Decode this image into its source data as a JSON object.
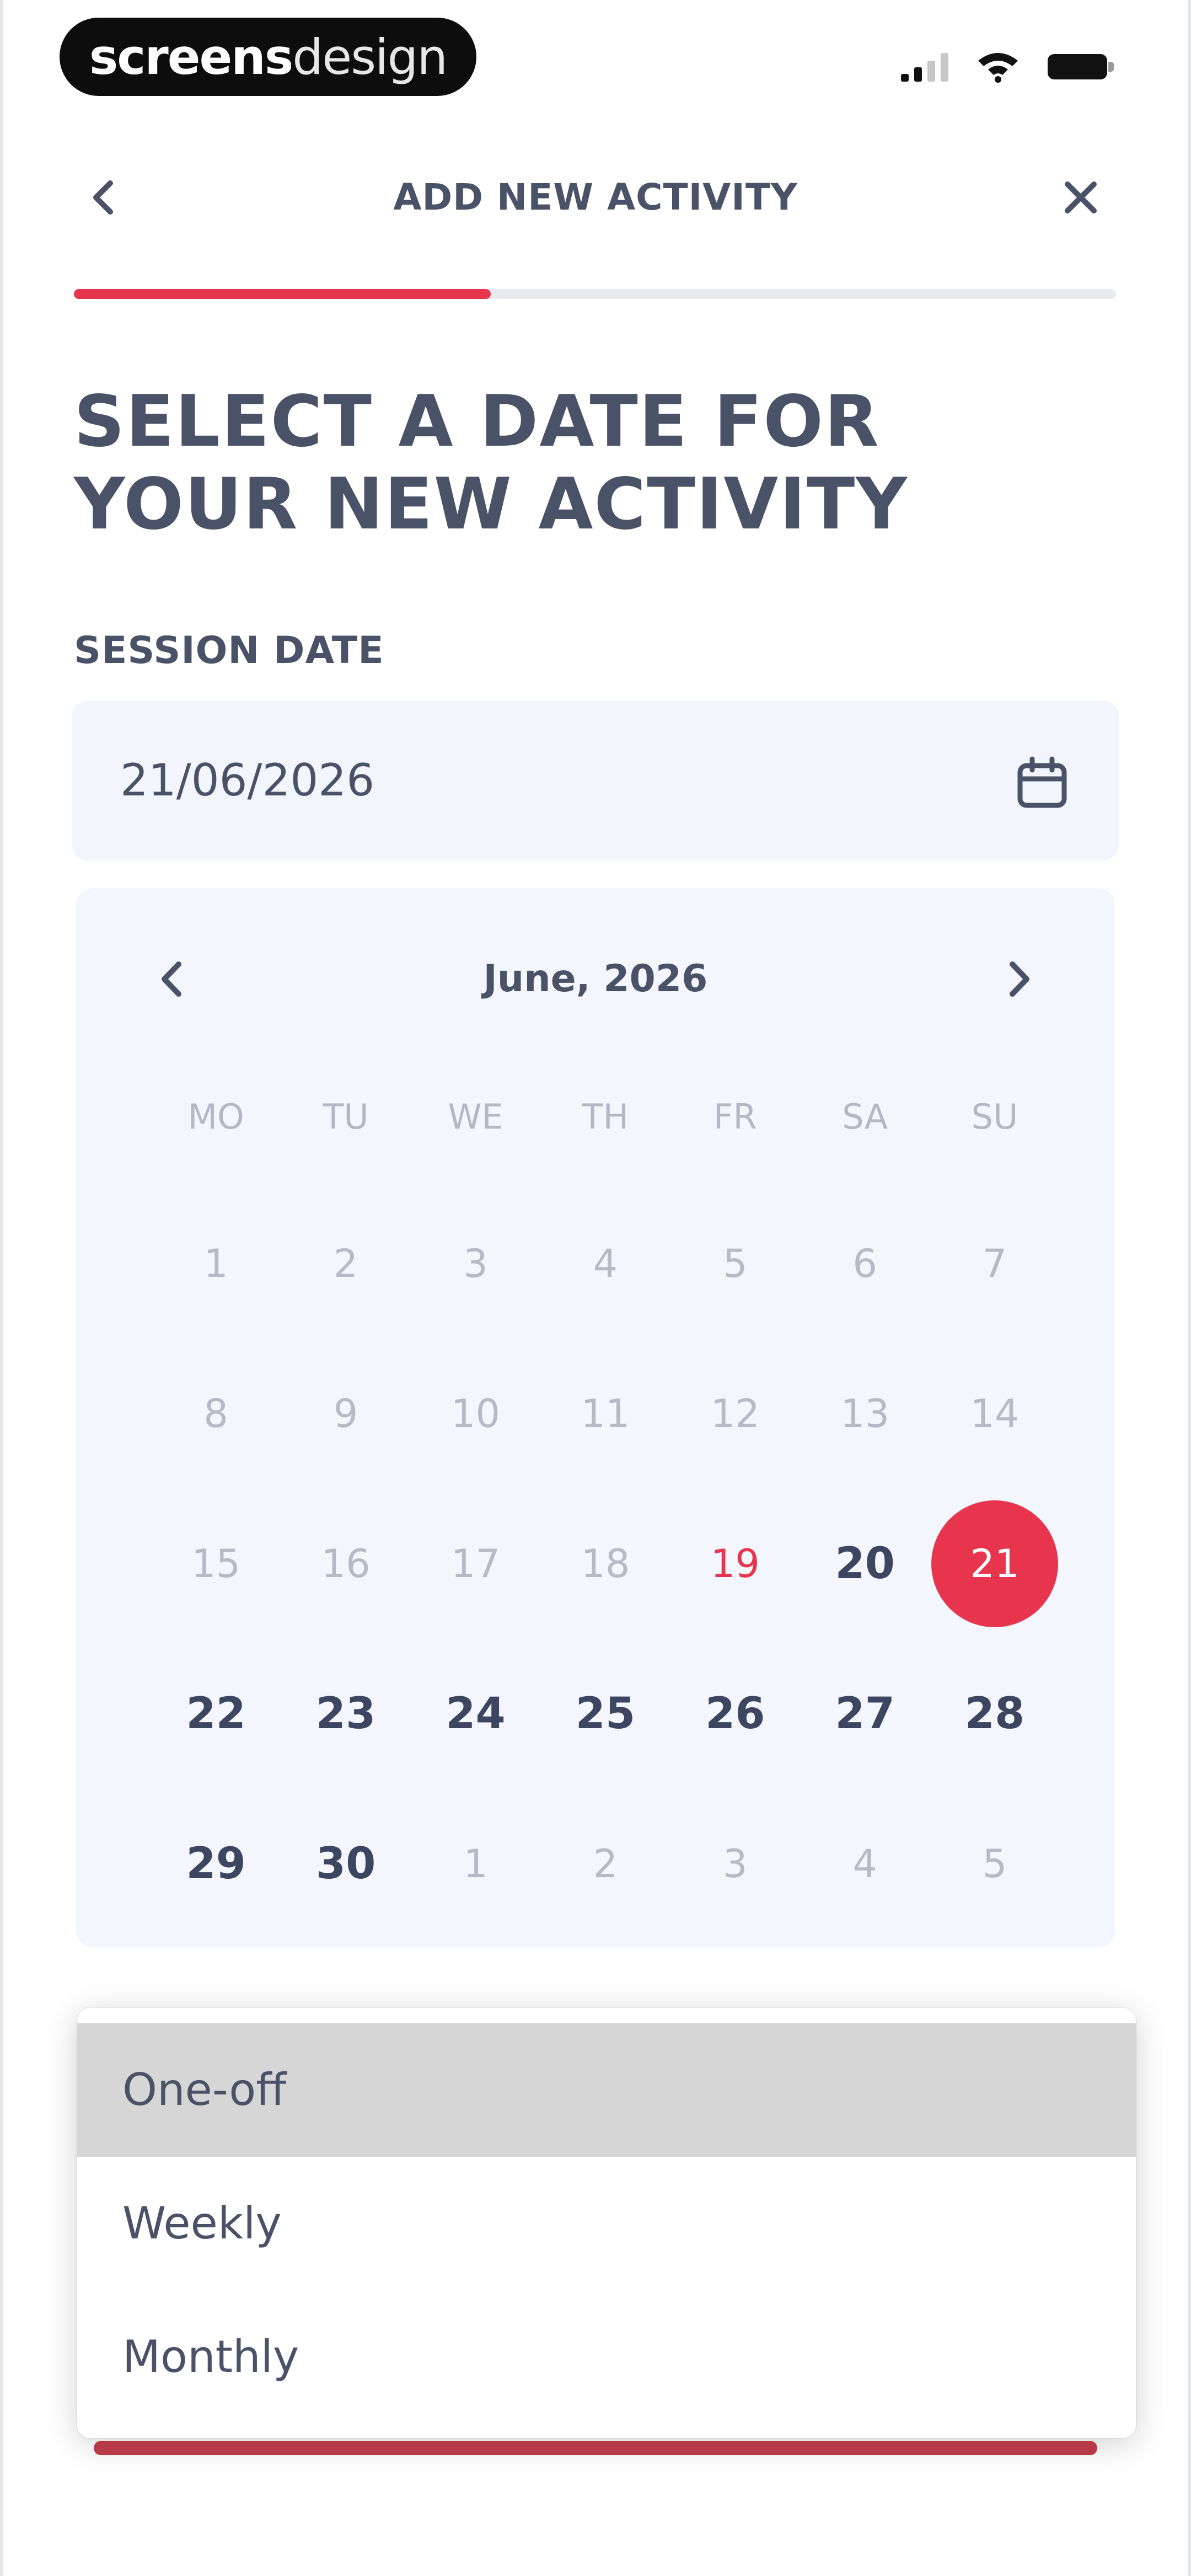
{
  "status_bar": {
    "brand_part1": "screens",
    "brand_part2": "design"
  },
  "header": {
    "title": "ADD NEW ACTIVITY",
    "back_icon": "chevron-left-icon",
    "close_icon": "close-icon"
  },
  "progress": {
    "fraction": 0.4
  },
  "title": "SELECT A DATE FOR YOUR NEW ACTIVITY",
  "session_date": {
    "label": "SESSION DATE",
    "value": "21/06/2026",
    "icon": "calendar-icon"
  },
  "calendar": {
    "month": "June, 2026",
    "weekdays": [
      "MO",
      "TU",
      "WE",
      "TH",
      "FR",
      "SA",
      "SU"
    ],
    "days": [
      {
        "label": "1"
      },
      {
        "label": "2"
      },
      {
        "label": "3"
      },
      {
        "label": "4"
      },
      {
        "label": "5"
      },
      {
        "label": "6"
      },
      {
        "label": "7"
      },
      {
        "label": "8"
      },
      {
        "label": "9"
      },
      {
        "label": "10"
      },
      {
        "label": "11"
      },
      {
        "label": "12"
      },
      {
        "label": "13"
      },
      {
        "label": "14"
      },
      {
        "label": "15"
      },
      {
        "label": "16"
      },
      {
        "label": "17"
      },
      {
        "label": "18"
      },
      {
        "label": "19",
        "state": "today"
      },
      {
        "label": "20",
        "state": "active"
      },
      {
        "label": "21",
        "state": "selected"
      },
      {
        "label": "22",
        "state": "active"
      },
      {
        "label": "23",
        "state": "active"
      },
      {
        "label": "24",
        "state": "active"
      },
      {
        "label": "25",
        "state": "active"
      },
      {
        "label": "26",
        "state": "active"
      },
      {
        "label": "27",
        "state": "active"
      },
      {
        "label": "28",
        "state": "active"
      },
      {
        "label": "29",
        "state": "active"
      },
      {
        "label": "30",
        "state": "active"
      },
      {
        "label": "1"
      },
      {
        "label": "2"
      },
      {
        "label": "3"
      },
      {
        "label": "4"
      },
      {
        "label": "5"
      }
    ]
  },
  "frequency_dropdown": {
    "options": [
      "One-off",
      "Weekly",
      "Monthly"
    ],
    "highlighted": "One-off"
  },
  "colors": {
    "accent": "#e8354e",
    "text": "#4a5268",
    "panel": "#f3f6fc"
  }
}
